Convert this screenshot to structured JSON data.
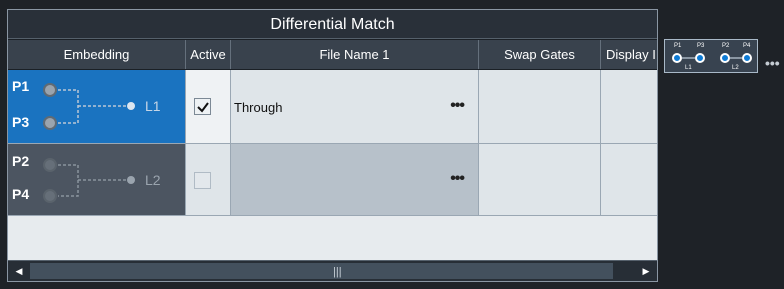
{
  "window": {
    "title": "Differential Match"
  },
  "table": {
    "headers": [
      "Embedding",
      "Active",
      "File Name 1",
      "Swap Gates",
      "Display I"
    ],
    "rows": [
      {
        "ports": [
          "P1",
          "P3"
        ],
        "logical_port": "L1",
        "active": true,
        "file_name": "Through",
        "more": "•••"
      },
      {
        "ports": [
          "P2",
          "P4"
        ],
        "logical_port": "L2",
        "active": false,
        "file_name": "",
        "more": "•••"
      }
    ]
  },
  "scrollbar": {
    "left_arrow": "◀",
    "right_arrow": "▶",
    "grip": "|||"
  },
  "mini_diagram": {
    "ports": [
      "P1",
      "P3",
      "P2",
      "P4"
    ],
    "logical_ports": [
      "L1",
      "L2"
    ],
    "more": "•••"
  },
  "colors": {
    "accent": "#1a73c0",
    "header": "#39424d",
    "background": "#1e2227"
  },
  "icons": [
    "port-connector-icon",
    "checkmark-icon",
    "more-options-icon",
    "left-arrow-icon",
    "right-arrow-icon"
  ]
}
